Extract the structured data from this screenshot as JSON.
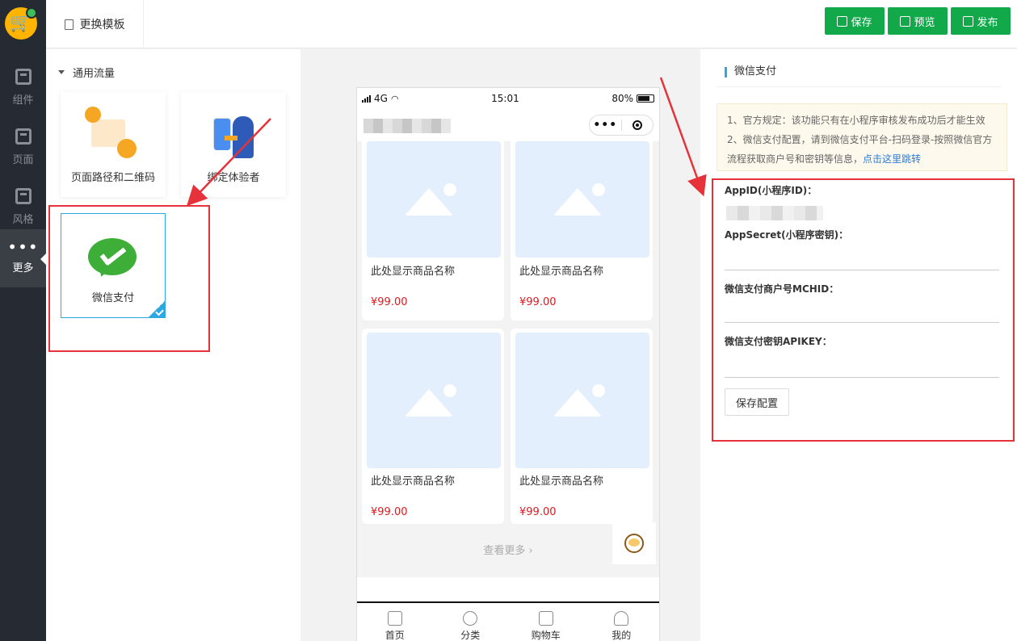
{
  "sidebar": {
    "items": [
      {
        "label": "组件",
        "icon": "component-icon"
      },
      {
        "label": "页面",
        "icon": "page-icon"
      },
      {
        "label": "风格",
        "icon": "style-icon"
      },
      {
        "label": "更多",
        "icon": "more-icon",
        "active": true
      }
    ]
  },
  "topbar": {
    "template_label": "更换模板",
    "save_label": "保存",
    "preview_label": "预览",
    "publish_label": "发布"
  },
  "components": {
    "group_title": "通用流量",
    "items": [
      {
        "label": "页面路径和二维码"
      },
      {
        "label": "绑定体验者"
      },
      {
        "label": "微信支付",
        "selected": true
      }
    ]
  },
  "phone": {
    "carrier": "4G",
    "time": "15:01",
    "battery": "80%",
    "capsule_more": "•••",
    "goods": [
      {
        "name": "此处显示商品名称",
        "price": "¥99.00"
      },
      {
        "name": "此处显示商品名称",
        "price": "¥99.00"
      },
      {
        "name": "此处显示商品名称",
        "price": "¥99.00"
      },
      {
        "name": "此处显示商品名称",
        "price": "¥99.00"
      }
    ],
    "more_label": "查看更多",
    "tabs": [
      {
        "label": "首页"
      },
      {
        "label": "分类"
      },
      {
        "label": "购物车"
      },
      {
        "label": "我的"
      }
    ]
  },
  "config": {
    "title": "微信支付",
    "notice_line1": "1、官方规定：该功能只有在小程序审核发布成功后才能生效",
    "notice_line2": "2、微信支付配置，请到微信支付平台-扫码登录-按照微信官方流程获取商户号和密钥等信息，",
    "notice_link": "点击这里跳转",
    "appid_label": "AppID(小程序ID)：",
    "appsecret_label": "AppSecret(小程序密钥)：",
    "mchid_label": "微信支付商户号MCHID：",
    "apikey_label": "微信支付密钥APIKEY：",
    "save_config_label": "保存配置"
  },
  "colors": {
    "sidebar_bg": "#262b33",
    "primary_green": "#12a94a",
    "accent_blue": "#2da9e1",
    "highlight_red": "#e5323b",
    "price_red": "#e0181e"
  }
}
